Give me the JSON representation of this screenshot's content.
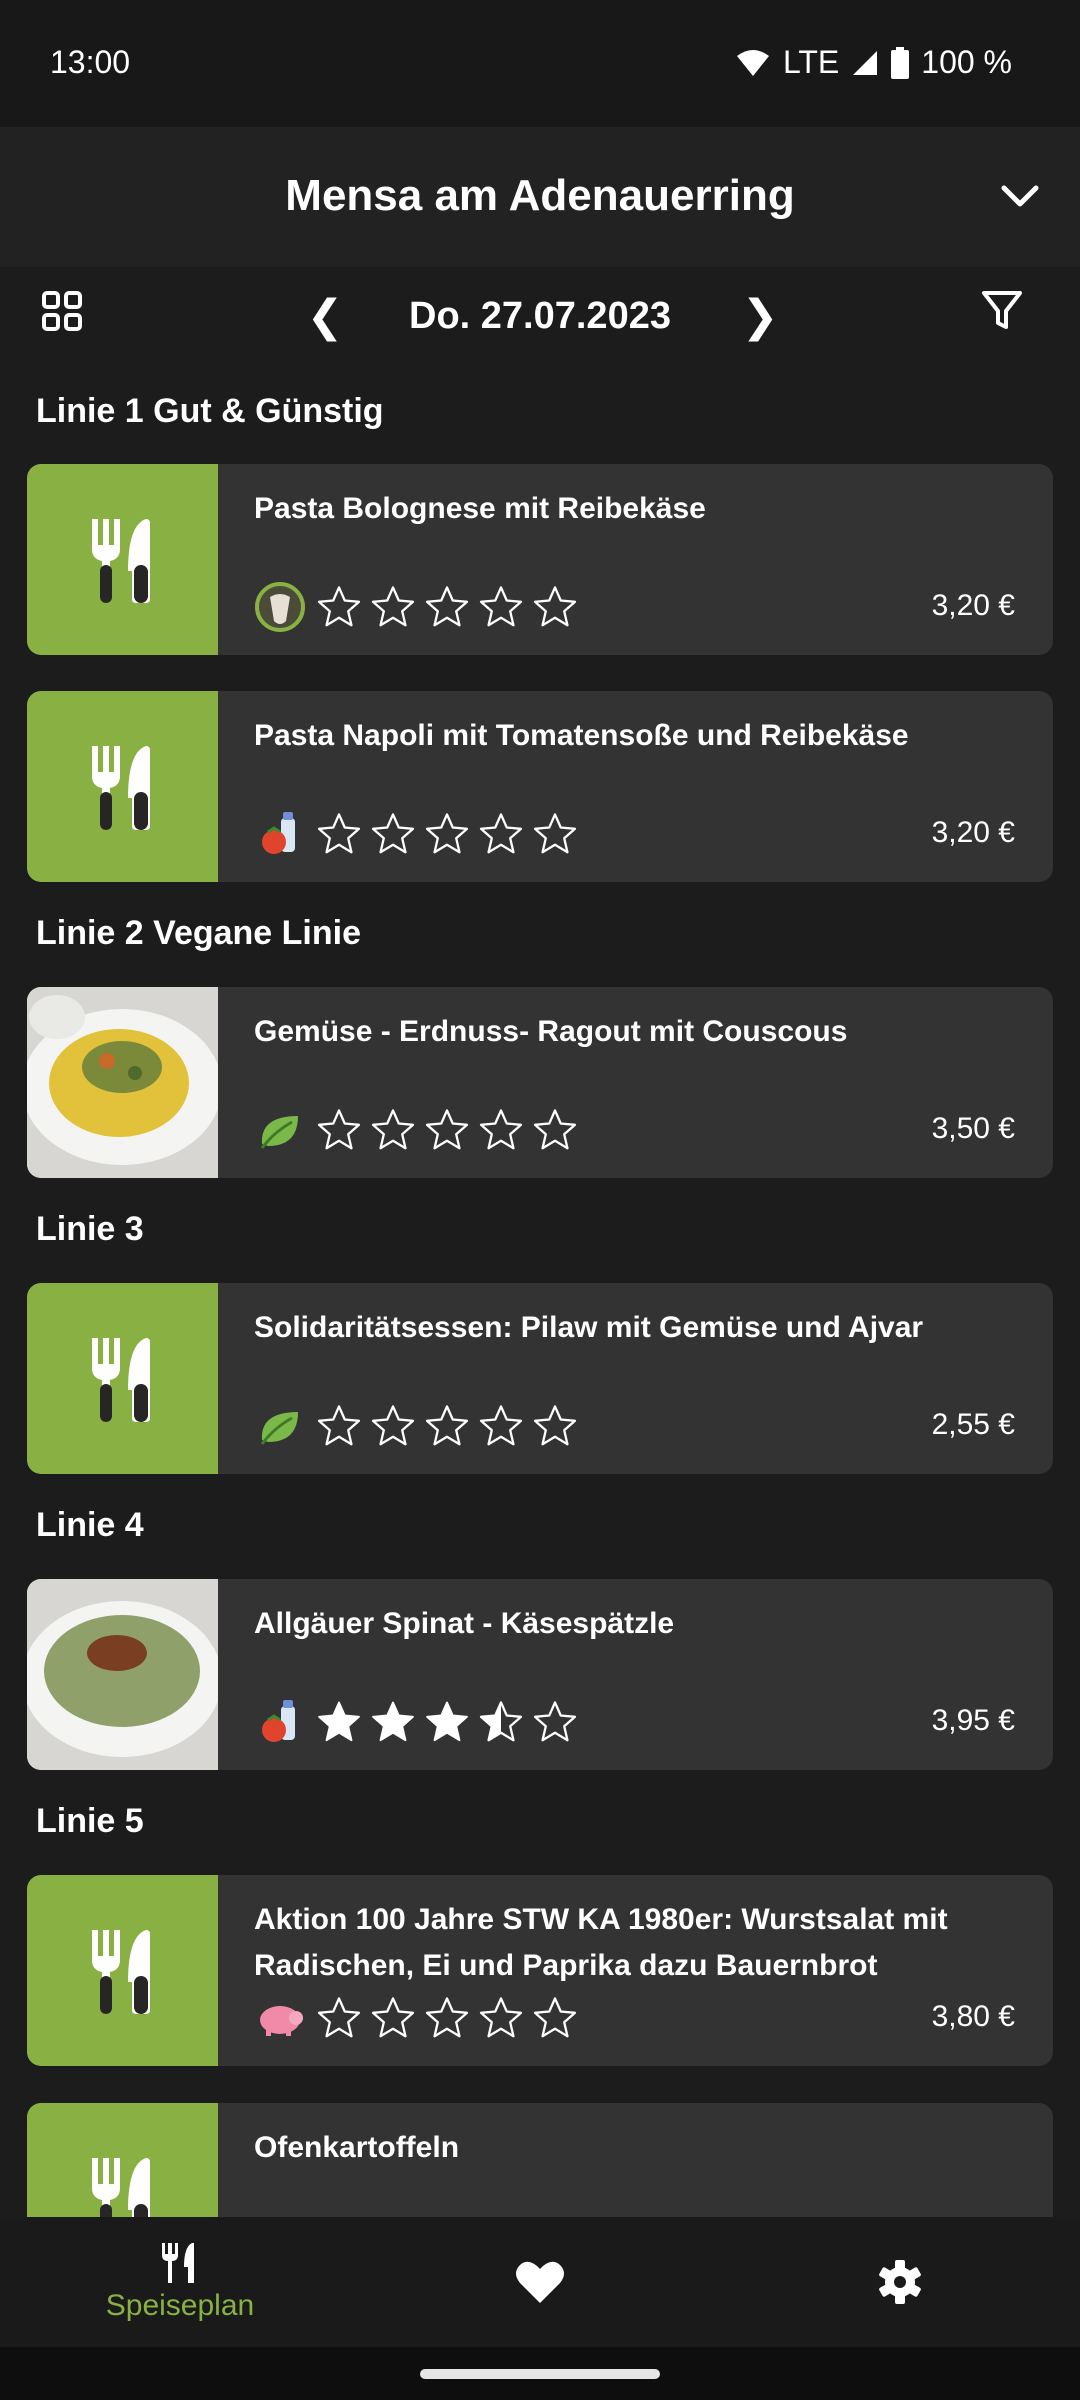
{
  "status_bar": {
    "time": "13:00",
    "network": "LTE",
    "battery": "100 %"
  },
  "header": {
    "title": "Mensa am Adenauerring"
  },
  "toolbar": {
    "prev": "❮",
    "date": "Do. 27.07.2023",
    "next": "❯"
  },
  "lines": [
    {
      "heading": "Linie 1 Gut & Günstig"
    },
    {
      "heading": "Linie 2 Vegane Linie"
    },
    {
      "heading": "Linie 3"
    },
    {
      "heading": "Linie 4"
    },
    {
      "heading": "Linie 5"
    }
  ],
  "meals": [
    {
      "name": "Pasta Bolognese mit Reibekäse",
      "price": "3,20 €",
      "diet_icon": "beef-icon",
      "rating": 0,
      "image": "cutlery-icon"
    },
    {
      "name": "Pasta Napoli mit Tomatensoße und Reibekäse",
      "price": "3,20 €",
      "diet_icon": "vegetarian-icon",
      "rating": 0,
      "image": "cutlery-icon"
    },
    {
      "name": "Gemüse - Erdnuss- Ragout mit Couscous",
      "price": "3,50 €",
      "diet_icon": "vegan-leaf-icon",
      "rating": 0,
      "image": "meal-photo"
    },
    {
      "name": "Solidaritätsessen: Pilaw mit Gemüse und Ajvar",
      "price": "2,55 €",
      "diet_icon": "vegan-leaf-icon",
      "rating": 0,
      "image": "cutlery-icon"
    },
    {
      "name": "Allgäuer Spinat - Käsespätzle",
      "price": "3,95 €",
      "diet_icon": "vegetarian-icon",
      "rating": 3.5,
      "image": "meal-photo"
    },
    {
      "name": "Aktion 100 Jahre STW KA 1980er: Wurstsalat mit Radischen, Ei und Paprika dazu Bauernbrot",
      "price": "3,80 €",
      "diet_icon": "pork-icon",
      "rating": 0,
      "image": "cutlery-icon"
    },
    {
      "name": "Ofenkartoffeln",
      "price": "",
      "diet_icon": "",
      "rating": 0,
      "image": "cutlery-icon"
    }
  ],
  "bottom_nav": {
    "menu_label": "Speiseplan"
  },
  "colors": {
    "accent": "#88b042",
    "card": "#333333",
    "background": "#1c1c1c"
  }
}
